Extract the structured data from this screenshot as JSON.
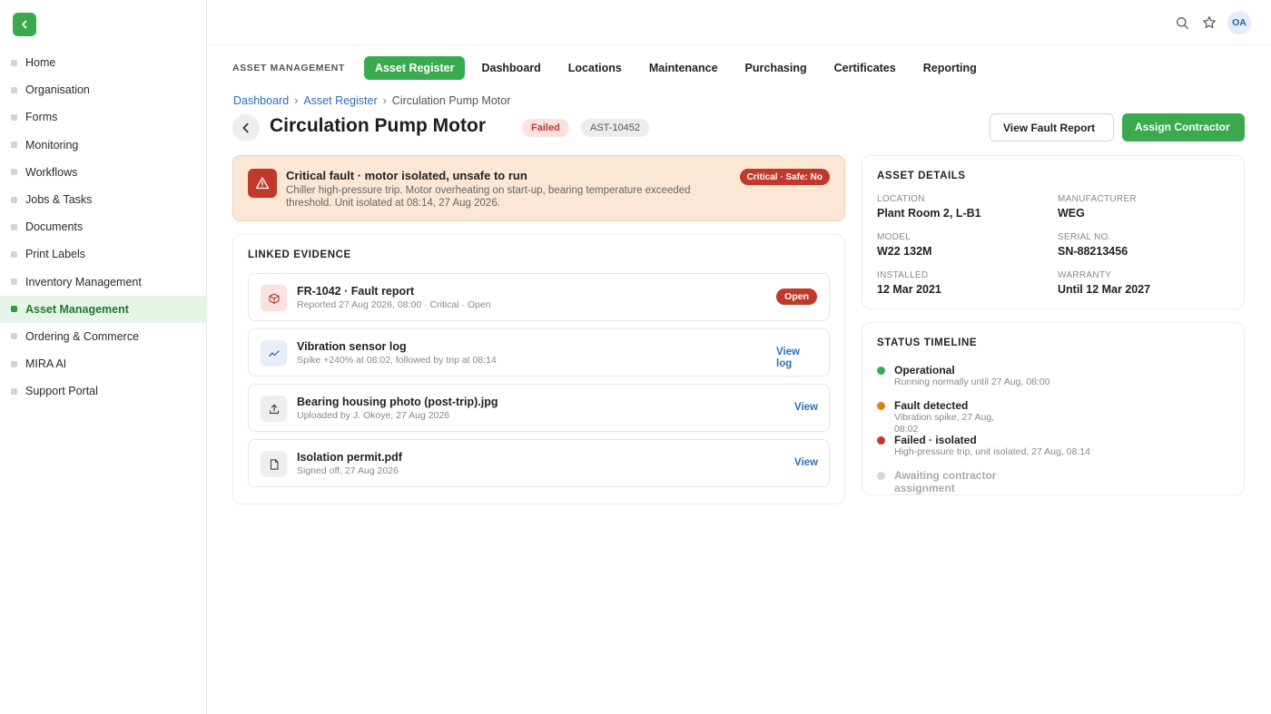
{
  "sidebar": {
    "items": [
      {
        "label": "Home"
      },
      {
        "label": "Organisation"
      },
      {
        "label": "Forms"
      },
      {
        "label": "Monitoring"
      },
      {
        "label": "Workflows"
      },
      {
        "label": "Jobs & Tasks"
      },
      {
        "label": "Documents"
      },
      {
        "label": "Print Labels"
      },
      {
        "label": "Inventory Management"
      },
      {
        "label": "Asset Management"
      },
      {
        "label": "Ordering & Commerce"
      },
      {
        "label": "MIRA AI"
      },
      {
        "label": "Support Portal"
      }
    ]
  },
  "header": {
    "avatar_initials": "OA"
  },
  "tabs": {
    "module_label": "ASSET MANAGEMENT",
    "items": [
      {
        "label": "Asset Register"
      },
      {
        "label": "Dashboard"
      },
      {
        "label": "Locations"
      },
      {
        "label": "Maintenance"
      },
      {
        "label": "Purchasing"
      },
      {
        "label": "Certificates"
      },
      {
        "label": "Reporting"
      }
    ]
  },
  "breadcrumb": [
    "Dashboard",
    "Asset Register",
    "Circulation Pump Motor"
  ],
  "page": {
    "title": "Circulation Pump Motor",
    "status": "Failed",
    "asset_id": "AST-10452",
    "view_fault_report": "View Fault Report",
    "assign_contractor": "Assign Contractor"
  },
  "alert": {
    "title": "Critical fault · motor isolated, unsafe to run",
    "text": "Chiller high-pressure trip. Motor overheating on start-up, bearing temperature exceeded threshold. Unit isolated at 08:14, 27 Aug 2026.",
    "badge": "Critical · Safe: No"
  },
  "evidence": {
    "title": "LINKED EVIDENCE",
    "items": [
      {
        "title": "FR-1042 · Fault report",
        "sub": "Reported 27 Aug 2026, 08:00 · Critical · Open",
        "action": "Open"
      },
      {
        "title": "Vibration sensor log",
        "sub": "Spike +240% at 08:02, followed by trip at 08:14",
        "action": "View log"
      },
      {
        "title": "Bearing housing photo (post-trip).jpg",
        "sub": "Uploaded by J. Okoye, 27 Aug 2026",
        "action": "View"
      },
      {
        "title": "Isolation permit.pdf",
        "sub": "Signed off, 27 Aug 2026",
        "action": "View"
      }
    ]
  },
  "details": {
    "title": "ASSET DETAILS",
    "location_label": "LOCATION",
    "location": "Plant Room 2, L-B1",
    "manufacturer_label": "MANUFACTURER",
    "manufacturer": "WEG",
    "model_label": "MODEL",
    "model": "W22 132M",
    "serial_label": "SERIAL NO.",
    "serial": "SN-88213456",
    "installed_label": "INSTALLED",
    "installed": "12 Mar 2021",
    "warranty_label": "WARRANTY",
    "warranty": "Until 12 Mar 2027"
  },
  "timeline": {
    "title": "STATUS TIMELINE",
    "items": [
      {
        "title": "Operational",
        "sub": "Running normally until 27 Aug, 08:00",
        "color": "#3aaa4f"
      },
      {
        "title": "Fault detected",
        "sub": "Vibration spike, 27 Aug, 08:02",
        "color": "#d9820f"
      },
      {
        "title": "Failed · isolated",
        "sub": "High-pressure trip, unit isolated, 27 Aug, 08:14",
        "color": "#c0392b"
      },
      {
        "title": "Awaiting contractor assignment",
        "sub": "",
        "color": "#d6d6d6"
      }
    ]
  }
}
